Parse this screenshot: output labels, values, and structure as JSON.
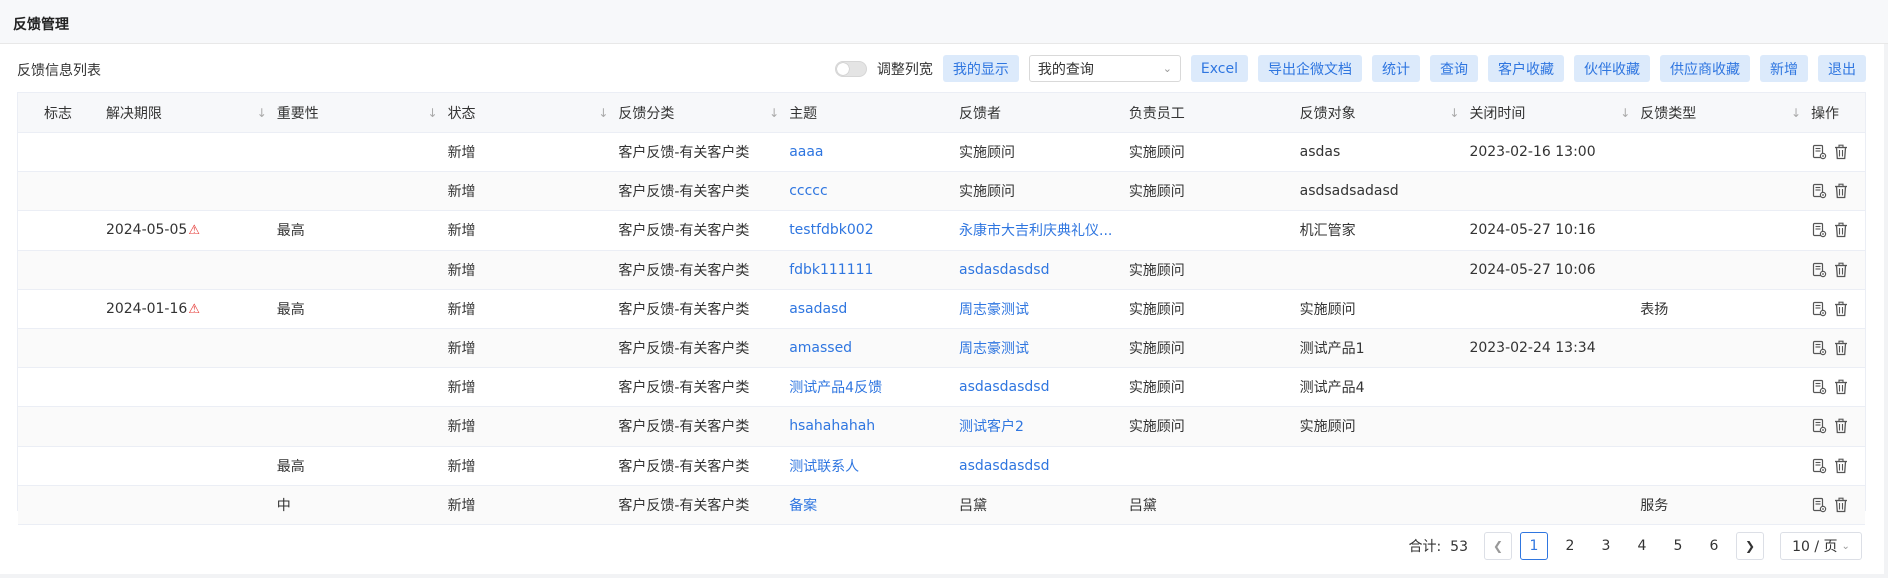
{
  "page": {
    "title": "反馈管理"
  },
  "list": {
    "title": "反馈信息列表"
  },
  "toolbar": {
    "adjust_columns_label": "调整列宽",
    "my_display": "我的显示",
    "my_query": "我的查询",
    "excel": "Excel",
    "export_wecom": "导出企微文档",
    "stats": "统计",
    "query": "查询",
    "customer_fav": "客户收藏",
    "partner_fav": "伙伴收藏",
    "supplier_fav": "供应商收藏",
    "add": "新增",
    "exit": "退出"
  },
  "columns": [
    "标志",
    "解决期限",
    "重要性",
    "状态",
    "反馈分类",
    "主题",
    "反馈者",
    "负责员工",
    "反馈对象",
    "关闭时间",
    "反馈类型",
    "操作"
  ],
  "rows": [
    {
      "flag": "",
      "deadline": "",
      "warn": false,
      "importance": "",
      "status": "新增",
      "category": "客户反馈-有关客户类",
      "subject": "aaaa",
      "reporter": "实施顾问",
      "reporter_link": false,
      "owner": "实施顾问",
      "target": "asdas",
      "closed": "2023-02-16 13:00",
      "type": ""
    },
    {
      "flag": "",
      "deadline": "",
      "warn": false,
      "importance": "",
      "status": "新增",
      "category": "客户反馈-有关客户类",
      "subject": "ccccc",
      "reporter": "实施顾问",
      "reporter_link": false,
      "owner": "实施顾问",
      "target": "asdsadsadasd",
      "closed": "",
      "type": ""
    },
    {
      "flag": "",
      "deadline": "2024-05-05",
      "warn": true,
      "importance": "最高",
      "status": "新增",
      "category": "客户反馈-有关客户类",
      "subject": "testfdbk002",
      "reporter": "永康市大吉利庆典礼仪...",
      "reporter_link": true,
      "owner": "",
      "target": "机汇管家",
      "closed": "2024-05-27 10:16",
      "type": ""
    },
    {
      "flag": "",
      "deadline": "",
      "warn": false,
      "importance": "",
      "status": "新增",
      "category": "客户反馈-有关客户类",
      "subject": "fdbk111111",
      "reporter": "asdasdasdsd",
      "reporter_link": true,
      "owner": "实施顾问",
      "target": "",
      "closed": "2024-05-27 10:06",
      "type": ""
    },
    {
      "flag": "",
      "deadline": "2024-01-16",
      "warn": true,
      "importance": "最高",
      "status": "新增",
      "category": "客户反馈-有关客户类",
      "subject": "asadasd",
      "reporter": "周志豪测试",
      "reporter_link": true,
      "owner": "实施顾问",
      "target": "实施顾问",
      "closed": "",
      "type": "表扬"
    },
    {
      "flag": "",
      "deadline": "",
      "warn": false,
      "importance": "",
      "status": "新增",
      "category": "客户反馈-有关客户类",
      "subject": "amassed",
      "reporter": "周志豪测试",
      "reporter_link": true,
      "owner": "实施顾问",
      "target": "测试产品1",
      "closed": "2023-02-24 13:34",
      "type": ""
    },
    {
      "flag": "",
      "deadline": "",
      "warn": false,
      "importance": "",
      "status": "新增",
      "category": "客户反馈-有关客户类",
      "subject": "测试产品4反馈",
      "reporter": "asdasdasdsd",
      "reporter_link": true,
      "owner": "实施顾问",
      "target": "测试产品4",
      "closed": "",
      "type": ""
    },
    {
      "flag": "",
      "deadline": "",
      "warn": false,
      "importance": "",
      "status": "新增",
      "category": "客户反馈-有关客户类",
      "subject": "hsahahahah",
      "reporter": "测试客户2",
      "reporter_link": true,
      "owner": "实施顾问",
      "target": "实施顾问",
      "closed": "",
      "type": ""
    },
    {
      "flag": "",
      "deadline": "",
      "warn": false,
      "importance": "最高",
      "status": "新增",
      "category": "客户反馈-有关客户类",
      "subject": "测试联系人",
      "reporter": "asdasdasdsd",
      "reporter_link": true,
      "owner": "",
      "target": "",
      "closed": "",
      "type": ""
    },
    {
      "flag": "",
      "deadline": "",
      "warn": false,
      "importance": "中",
      "status": "新增",
      "category": "客户反馈-有关客户类",
      "subject": "备案",
      "reporter": "吕黛",
      "reporter_link": false,
      "owner": "吕黛",
      "target": "",
      "closed": "",
      "type": "服务"
    }
  ],
  "pagination": {
    "total_label": "合计:",
    "total": "53",
    "pages": [
      "1",
      "2",
      "3",
      "4",
      "5",
      "6"
    ],
    "current": "1",
    "page_size": "10 / 页"
  },
  "colors": {
    "accent": "#2f76e0",
    "button_bg": "#dceafb",
    "warning": "#e53935"
  },
  "icons": {
    "sortable": "sort-arrow-down-icon",
    "deadline_warning": "warning-triangle-icon",
    "edit": "edit-doc-icon",
    "delete": "trash-icon"
  }
}
